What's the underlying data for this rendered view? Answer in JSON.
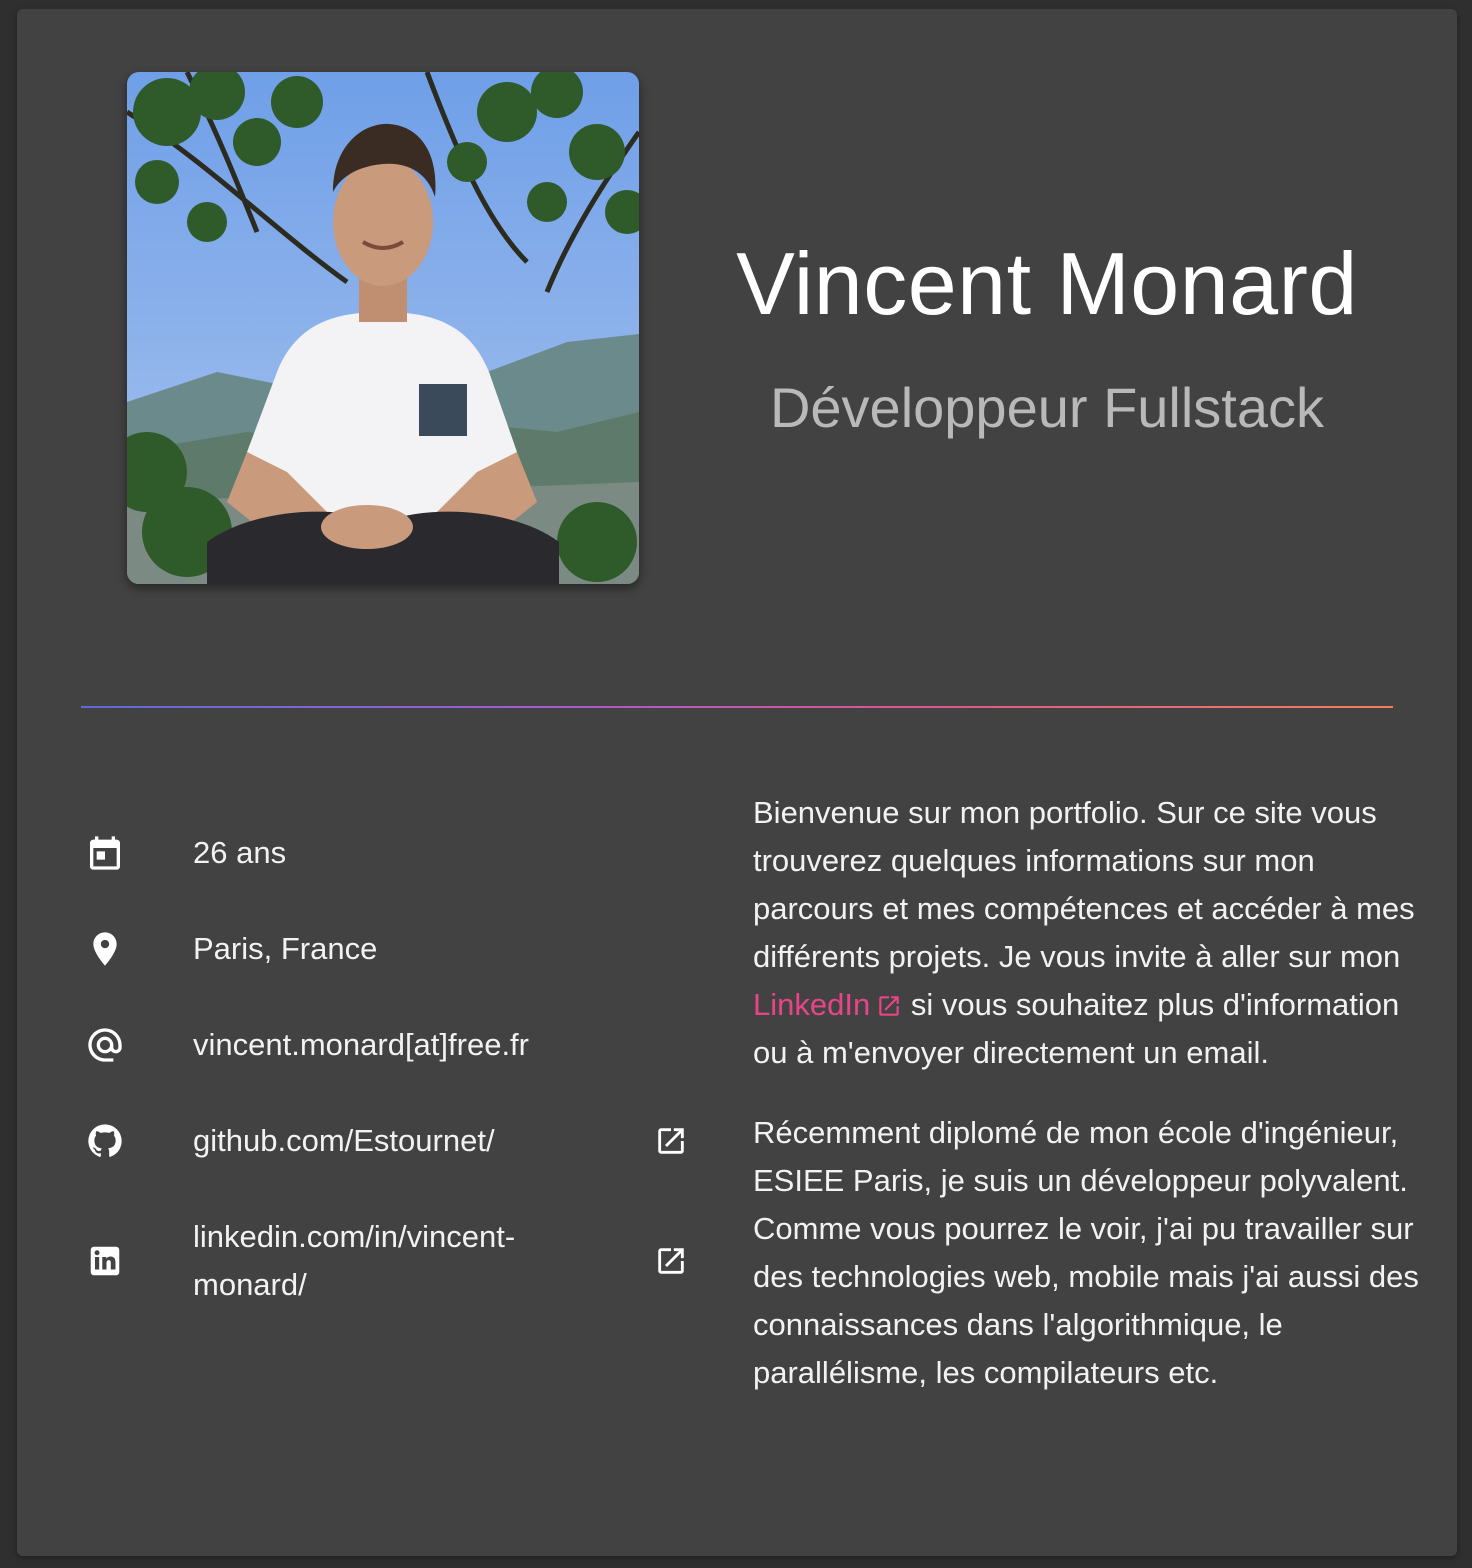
{
  "profile": {
    "name": "Vincent Monard",
    "title": "Développeur Fullstack"
  },
  "info": {
    "age": "26 ans",
    "location": "Paris, France",
    "email": "vincent.monard[at]free.fr",
    "github": "github.com/Estournet/",
    "linkedin_line1": "linkedin.com/in/vincent-",
    "linkedin_line2": "monard/"
  },
  "about": {
    "p1_before": "Bienvenue sur mon portfolio. Sur ce site vous trouverez quelques informations sur mon parcours et mes compétences et accéder à mes différents projets. Je vous invite à aller sur mon ",
    "p1_link": "LinkedIn",
    "p1_after": " si vous souhaitez plus d'information ou à m'envoyer directement un email.",
    "p2": "Récemment diplomé de mon école d'ingénieur, ESIEE Paris, je suis un développeur polyvalent. Comme vous pourrez le voir, j'ai pu travailler sur des technologies web, mobile mais j'ai aussi des connaissances dans l'algorithmique, le parallélisme, les compilateurs etc."
  },
  "icons": {
    "age": "calendar-icon",
    "location": "location-pin-icon",
    "email": "at-sign-icon",
    "github": "github-icon",
    "linkedin": "linkedin-icon",
    "external": "external-link-icon"
  },
  "colors": {
    "background": "#2f2f2f",
    "card": "#424242",
    "link": "#e84488",
    "subtitle": "#b9b9b9"
  }
}
